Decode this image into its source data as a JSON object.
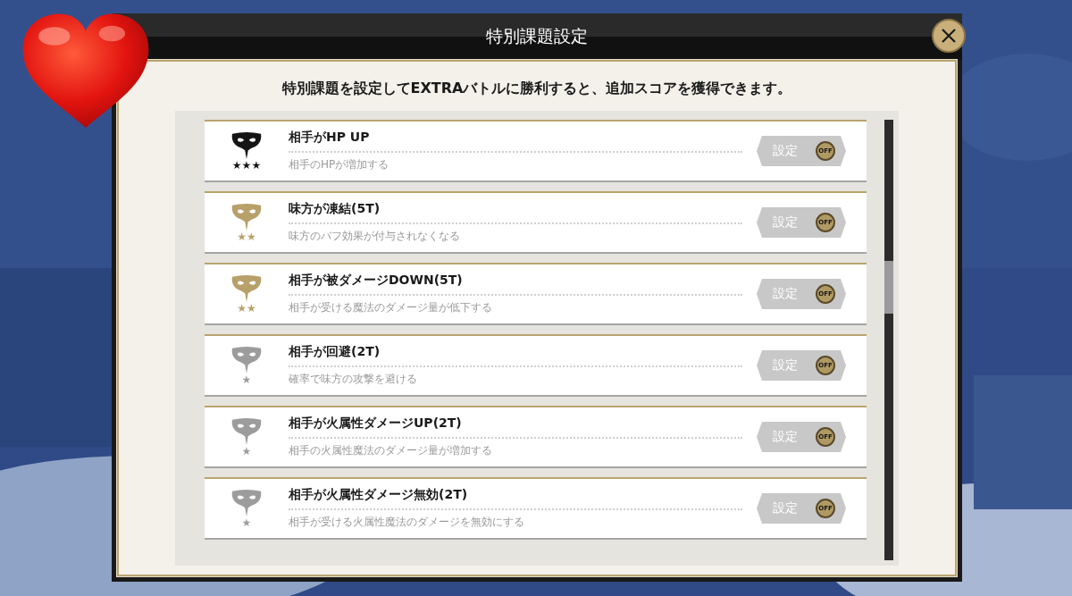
{
  "dialog": {
    "title": "特別課題設定",
    "intro": "特別課題を設定してEXTRAバトルに勝利すると、追加スコアを獲得できます。"
  },
  "rows": [
    {
      "title": "相手がHP UP",
      "description": "相手のHPが増加する",
      "rank": "★★★",
      "color": "#151515",
      "button": "設定",
      "state": "OFF",
      "on": false
    },
    {
      "title": "味方が凍結(5T)",
      "description": "味方のバフ効果が付与されなくなる",
      "rank": "★★",
      "color": "#b8a06a",
      "button": "設定",
      "state": "OFF",
      "on": false
    },
    {
      "title": "相手が被ダメージDOWN(5T)",
      "description": "相手が受ける魔法のダメージ量が低下する",
      "rank": "★★",
      "color": "#b8a06a",
      "button": "設定",
      "state": "OFF",
      "on": false
    },
    {
      "title": "相手が回避(2T)",
      "description": "確率で味方の攻撃を避ける",
      "rank": "★",
      "color": "#9c9c9c",
      "button": "設定",
      "state": "OFF",
      "on": false
    },
    {
      "title": "相手が火属性ダメージUP(2T)",
      "description": "相手の火属性魔法のダメージ量が増加する",
      "rank": "★",
      "color": "#9c9c9c",
      "button": "設定",
      "state": "OFF",
      "on": false
    },
    {
      "title": "相手が火属性ダメージ無効(2T)",
      "description": "相手が受ける火属性魔法のダメージを無効にする",
      "rank": "★",
      "color": "#9c9c9c",
      "button": "設定",
      "state": "OFF",
      "on": false
    }
  ]
}
